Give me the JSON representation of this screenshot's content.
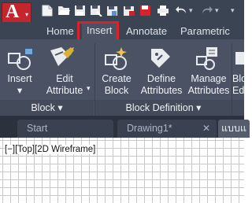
{
  "app": {
    "logo_letter": "A",
    "dropdown_glyph": "▾"
  },
  "qat": {
    "icons": [
      "new-icon",
      "open-icon",
      "save-icon",
      "saveas-icon",
      "cloud-icon",
      "plot-icon",
      "undo-icon",
      "redo-icon",
      "customize-icon"
    ],
    "sep": "▾"
  },
  "ribbon_tabs": [
    {
      "label": "Home"
    },
    {
      "label": "Insert",
      "active": true
    },
    {
      "label": "Annotate"
    },
    {
      "label": "Parametric"
    }
  ],
  "ribbon": {
    "insert": {
      "line1": "Insert",
      "arrow": "▾"
    },
    "edit_attribute": {
      "line1": "Edit",
      "line2": "Attribute",
      "arrow": "▾"
    },
    "create_block": {
      "line1": "Create",
      "line2": "Block"
    },
    "define_attributes": {
      "line1": "Define",
      "line2": "Attributes"
    },
    "manage_attributes": {
      "line1": "Manage",
      "line2": "Attributes"
    },
    "block_editor": {
      "line1": "Blo",
      "line2": "Edi"
    },
    "panels": {
      "block": "Block ▾",
      "block_definition": "Block Definition ▾"
    }
  },
  "file_tabs": {
    "start": "Start",
    "drawing1": "Drawing1*",
    "drawing2": "แบบแ",
    "close": "✕"
  },
  "viewport": {
    "label": "[−][Top][2D Wireframe]"
  },
  "colors": {
    "accent_red": "#d8232a",
    "ribbon_bg": "#4a5263",
    "title_bg": "#3b4453"
  }
}
